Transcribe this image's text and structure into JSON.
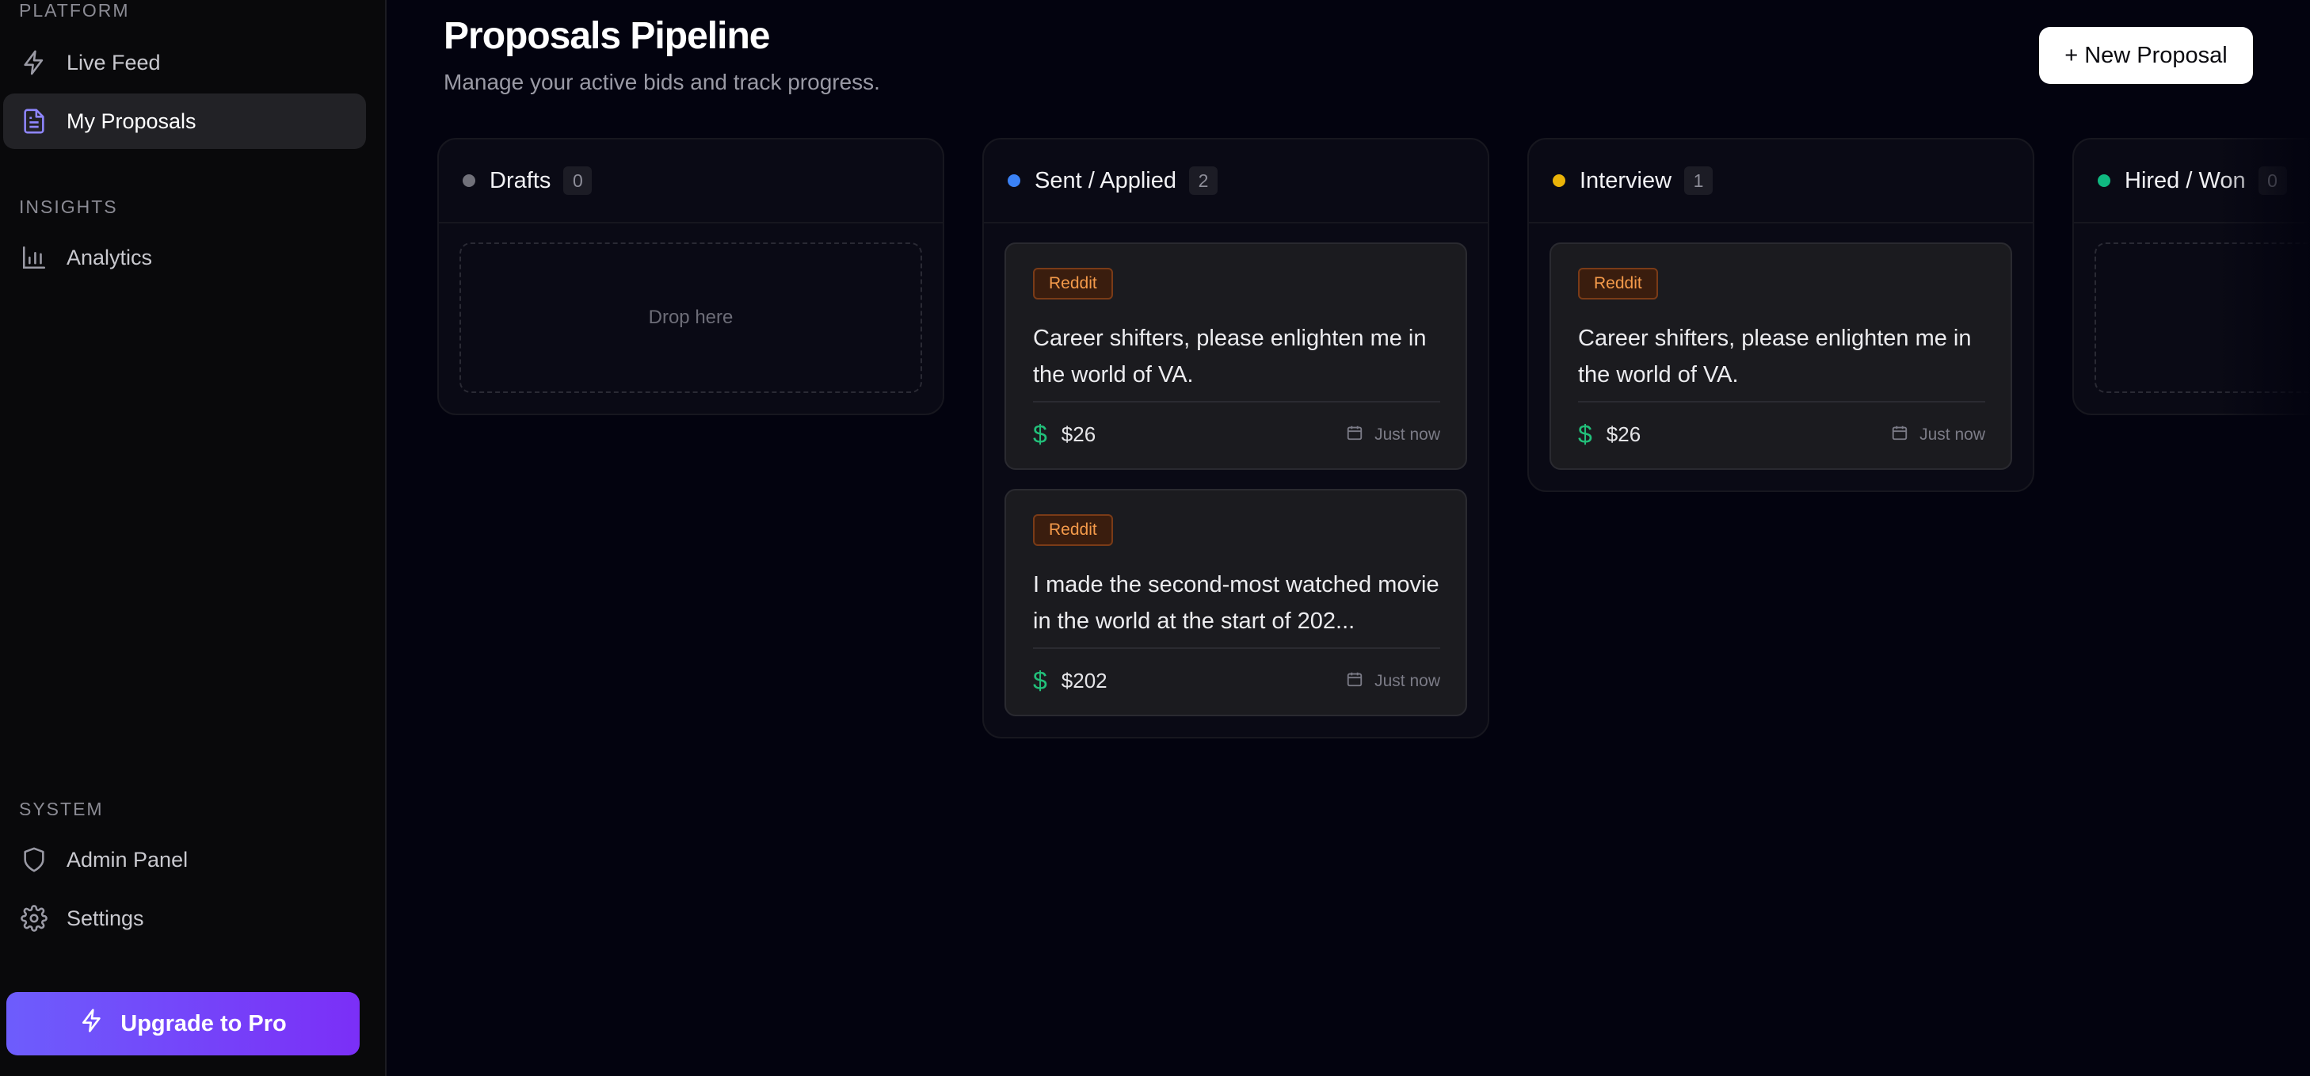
{
  "sidebar": {
    "sections": [
      {
        "label": "PLATFORM"
      },
      {
        "label": "INSIGHTS"
      },
      {
        "label": "SYSTEM"
      }
    ],
    "items": [
      {
        "label": "Live Feed",
        "icon": "lightning-icon"
      },
      {
        "label": "My Proposals",
        "icon": "document-icon",
        "active": true
      },
      {
        "label": "Analytics",
        "icon": "bar-chart-icon"
      },
      {
        "label": "Admin Panel",
        "icon": "shield-icon"
      },
      {
        "label": "Settings",
        "icon": "gear-icon"
      }
    ],
    "upgrade_label": "Upgrade to Pro"
  },
  "header": {
    "title": "Proposals Pipeline",
    "subtitle": "Manage your active bids and track progress.",
    "new_button_label": "+ New Proposal"
  },
  "colors": {
    "drafts": "#71717a",
    "sent": "#3b82f6",
    "interview": "#eab308",
    "hired": "#10b981",
    "accent": "#6d5dfc",
    "price": "#22c07a"
  },
  "columns": [
    {
      "title": "Drafts",
      "count": "0",
      "drop_text": "Drop here",
      "cards": []
    },
    {
      "title": "Sent / Applied",
      "count": "2",
      "cards": [
        {
          "tag": "Reddit",
          "title": "Career shifters, please enlighten me in the world of VA.",
          "price": "$26",
          "date": "Just now"
        },
        {
          "tag": "Reddit",
          "title": "I made the second-most watched movie in the world at the start of 202...",
          "price": "$202",
          "date": "Just now"
        }
      ]
    },
    {
      "title": "Interview",
      "count": "1",
      "cards": [
        {
          "tag": "Reddit",
          "title": "Career shifters, please enlighten me in the world of VA.",
          "price": "$26",
          "date": "Just now"
        }
      ]
    },
    {
      "title": "Hired / Won",
      "count": "0",
      "cards": []
    }
  ]
}
